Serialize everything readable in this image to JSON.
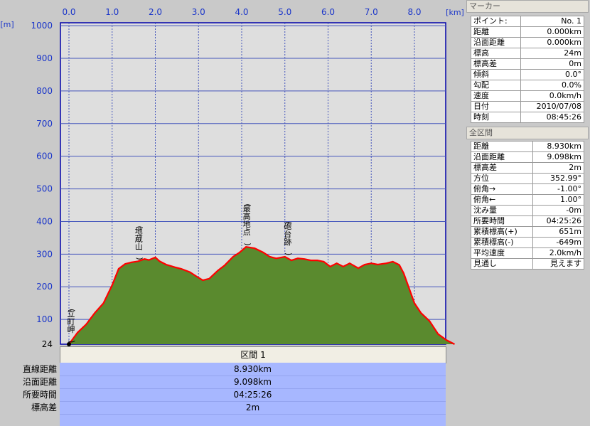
{
  "chart_data": {
    "type": "area",
    "x_unit_label": "[km]",
    "y_unit_label": "[m]",
    "xlim": [
      0,
      9
    ],
    "ylim": [
      0,
      1000
    ],
    "x_ticks": [
      "0.0",
      "1.0",
      "2.0",
      "3.0",
      "4.0",
      "5.0",
      "6.0",
      "7.0",
      "8.0"
    ],
    "y_ticks": [
      "1000",
      "900",
      "800",
      "700",
      "600",
      "500",
      "400",
      "300",
      "200",
      "100"
    ],
    "y_min_label": "24",
    "grid": true,
    "colors": {
      "fill": "#5a8a2e",
      "line": "#ff0000",
      "grid": "#4455bb",
      "plot_bg": "#dedede",
      "tick_text": "#1a35c9"
    },
    "profile_x": [
      0,
      0.2,
      0.4,
      0.6,
      0.8,
      1.0,
      1.15,
      1.3,
      1.45,
      1.6,
      1.75,
      1.85,
      2.0,
      2.1,
      2.25,
      2.45,
      2.6,
      2.8,
      2.95,
      3.1,
      3.25,
      3.45,
      3.6,
      3.8,
      3.95,
      4.1,
      4.3,
      4.5,
      4.65,
      4.8,
      5.0,
      5.15,
      5.3,
      5.45,
      5.6,
      5.75,
      5.9,
      6.05,
      6.2,
      6.35,
      6.5,
      6.7,
      6.85,
      7.0,
      7.15,
      7.35,
      7.5,
      7.65,
      7.75,
      7.85,
      8.0,
      8.15,
      8.35,
      8.55,
      8.75,
      8.93
    ],
    "profile_y": [
      24,
      60,
      85,
      120,
      150,
      205,
      255,
      270,
      275,
      278,
      285,
      282,
      290,
      278,
      268,
      260,
      255,
      245,
      232,
      220,
      225,
      250,
      265,
      292,
      305,
      322,
      318,
      305,
      292,
      287,
      292,
      281,
      287,
      285,
      281,
      281,
      277,
      262,
      272,
      262,
      272,
      257,
      268,
      272,
      268,
      272,
      277,
      267,
      242,
      205,
      150,
      120,
      95,
      55,
      36,
      24
    ],
    "labels": [
      {
        "text": "(立町岬)",
        "x": 0.03,
        "y": 24
      },
      {
        "text": "(地蔵山)",
        "x": 1.6,
        "y": 278
      },
      {
        "text": "(最高地点)",
        "x": 4.1,
        "y": 322
      },
      {
        "text": "(砲台跡)",
        "x": 5.05,
        "y": 292
      }
    ]
  },
  "marker_panel": {
    "title": "マーカー",
    "rows": [
      {
        "label": "ポイント:",
        "value": "No. 1"
      },
      {
        "label": "距離",
        "value": "0.000km"
      },
      {
        "label": "沿面距離",
        "value": "0.000km"
      },
      {
        "label": "標高",
        "value": "24m"
      },
      {
        "label": "標高差",
        "value": "0m"
      },
      {
        "label": "傾斜",
        "value": "0.0°"
      },
      {
        "label": "勾配",
        "value": "0.0%"
      },
      {
        "label": "速度",
        "value": "0.0km/h"
      },
      {
        "label": "日付",
        "value": "2010/07/08"
      },
      {
        "label": "時刻",
        "value": "08:45:26"
      }
    ]
  },
  "section_panel": {
    "title": "全区間",
    "rows": [
      {
        "label": "距離",
        "value": "8.930km"
      },
      {
        "label": "沿面距離",
        "value": "9.098km"
      },
      {
        "label": "標高差",
        "value": "2m"
      },
      {
        "label": "方位",
        "value": "352.99°"
      },
      {
        "label": "俯角→",
        "value": "-1.00°"
      },
      {
        "label": "俯角←",
        "value": "1.00°"
      },
      {
        "label": "沈み量",
        "value": "-0m"
      },
      {
        "label": "所要時間",
        "value": "04:25:26"
      },
      {
        "label": "累積標高(+)",
        "value": "651m"
      },
      {
        "label": "累積標高(-)",
        "value": "-649m"
      },
      {
        "label": "平均速度",
        "value": "2.0km/h"
      },
      {
        "label": "見通し",
        "value": "見えます"
      }
    ]
  },
  "bottom": {
    "tab_label": "区間 1",
    "rows": [
      {
        "label": "直線距離",
        "value": "8.930km"
      },
      {
        "label": "沿面距離",
        "value": "9.098km"
      },
      {
        "label": "所要時間",
        "value": "04:25:26"
      },
      {
        "label": "標高差",
        "value": "2m"
      }
    ]
  }
}
